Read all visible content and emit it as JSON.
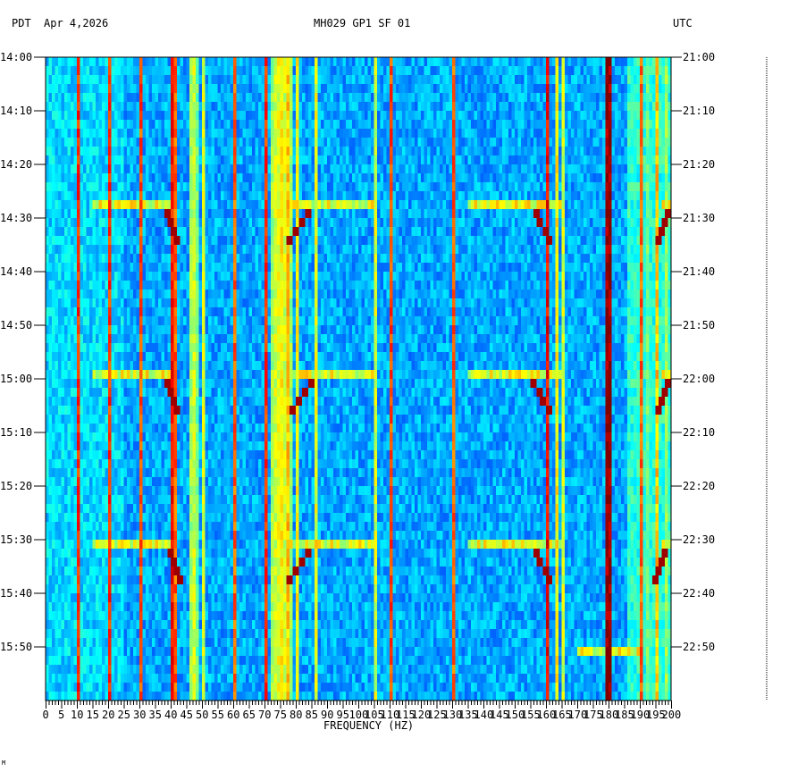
{
  "header": {
    "left_tz": "PDT",
    "date": "Apr 4,2026",
    "station": "MH029 GP1 SF 01",
    "right_tz": "UTC"
  },
  "chart_data": {
    "type": "heatmap",
    "title": "MH029 GP1 SF 01",
    "xlabel": "FREQUENCY (HZ)",
    "xlim": [
      0,
      200
    ],
    "x_ticks": [
      "0",
      "5",
      "10",
      "15",
      "20",
      "25",
      "30",
      "35",
      "40",
      "45",
      "50",
      "55",
      "60",
      "65",
      "70",
      "75",
      "80",
      "85",
      "90",
      "95",
      "100",
      "105",
      "110",
      "115",
      "120",
      "125",
      "130",
      "135",
      "140",
      "145",
      "150",
      "155",
      "160",
      "165",
      "170",
      "175",
      "180",
      "185",
      "190",
      "195",
      "200"
    ],
    "time_range_minutes": [
      0,
      120
    ],
    "y_ticks_left": [
      "14:00",
      "14:10",
      "14:20",
      "14:30",
      "14:40",
      "14:50",
      "15:00",
      "15:10",
      "15:20",
      "15:30",
      "15:40",
      "15:50"
    ],
    "y_ticks_right": [
      "21:00",
      "21:10",
      "21:20",
      "21:30",
      "21:40",
      "21:50",
      "22:00",
      "22:10",
      "22:20",
      "22:30",
      "22:40",
      "22:50"
    ],
    "colormap": "jet",
    "background_level": 0.22,
    "persistent_lines": [
      {
        "freq": 10,
        "level": 0.85
      },
      {
        "freq": 20,
        "level": 0.85
      },
      {
        "freq": 30,
        "level": 0.82
      },
      {
        "freq": 40,
        "level": 0.88
      },
      {
        "freq": 41,
        "level": 0.8
      },
      {
        "freq": 46,
        "level": 0.55
      },
      {
        "freq": 47,
        "level": 0.6
      },
      {
        "freq": 48,
        "level": 0.5
      },
      {
        "freq": 50,
        "level": 0.6
      },
      {
        "freq": 60,
        "level": 0.8
      },
      {
        "freq": 70,
        "level": 0.85
      },
      {
        "freq": 72,
        "level": 0.55
      },
      {
        "freq": 73,
        "level": 0.6
      },
      {
        "freq": 74,
        "level": 0.62
      },
      {
        "freq": 75,
        "level": 0.65
      },
      {
        "freq": 76,
        "level": 0.6
      },
      {
        "freq": 77,
        "level": 0.7
      },
      {
        "freq": 78,
        "level": 0.55
      },
      {
        "freq": 80,
        "level": 0.65
      },
      {
        "freq": 86,
        "level": 0.62
      },
      {
        "freq": 105,
        "level": 0.6
      },
      {
        "freq": 110,
        "level": 0.82
      },
      {
        "freq": 130,
        "level": 0.8
      },
      {
        "freq": 160,
        "level": 0.9
      },
      {
        "freq": 163,
        "level": 0.65
      },
      {
        "freq": 165,
        "level": 0.6
      },
      {
        "freq": 179,
        "level": 1.0
      },
      {
        "freq": 180,
        "level": 1.0
      },
      {
        "freq": 190,
        "level": 0.8
      },
      {
        "freq": 192,
        "level": 0.5
      },
      {
        "freq": 195,
        "level": 0.7
      },
      {
        "freq": 198,
        "level": 0.55
      }
    ],
    "events": [
      {
        "start_min": 26,
        "bands": [
          [
            15,
            42
          ],
          [
            78,
            105
          ],
          [
            135,
            165
          ],
          [
            197,
            200
          ]
        ]
      },
      {
        "start_min": 58,
        "bands": [
          [
            15,
            42
          ],
          [
            78,
            105
          ],
          [
            135,
            165
          ],
          [
            197,
            200
          ]
        ]
      },
      {
        "start_min": 89,
        "bands": [
          [
            15,
            42
          ],
          [
            78,
            105
          ],
          [
            135,
            165
          ],
          [
            197,
            200
          ]
        ]
      },
      {
        "start_min": 109,
        "bands": [
          [
            170,
            190
          ]
        ]
      }
    ]
  },
  "footer": {
    "mark": "M"
  }
}
